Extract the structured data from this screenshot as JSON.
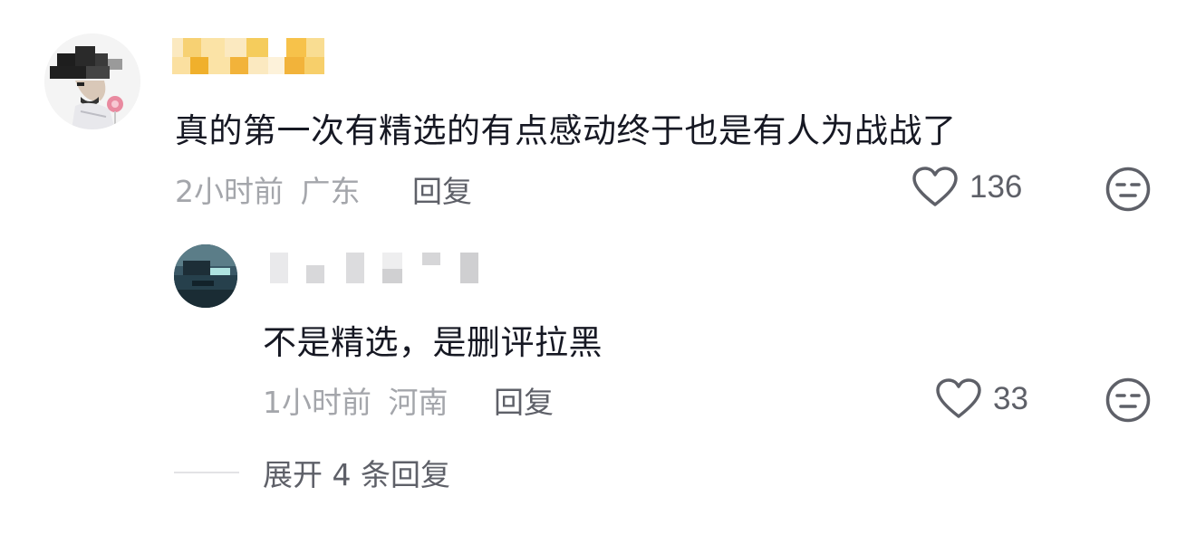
{
  "comment": {
    "text": "真的第一次有精选的有点感动终于也是有人为战战了",
    "time": "2小时前",
    "location": "广东",
    "reply_label": "回复",
    "likes": "136",
    "avatar_icon": "cartoon-avatar-icon",
    "like_icon": "heart-outline-icon",
    "dislike_icon": "neutral-face-icon"
  },
  "reply": {
    "text": "不是精选，是删评拉黑",
    "time": "1小时前",
    "location": "河南",
    "reply_label": "回复",
    "likes": "33",
    "avatar_icon": "landscape-avatar-icon",
    "like_icon": "heart-outline-icon",
    "dislike_icon": "neutral-face-icon"
  },
  "expand": {
    "label": "展开 4 条回复"
  },
  "colors": {
    "text_primary": "#161823",
    "text_secondary": "#a4a6ab",
    "text_action": "#5e6068",
    "username_blur": "#f2c03a"
  }
}
